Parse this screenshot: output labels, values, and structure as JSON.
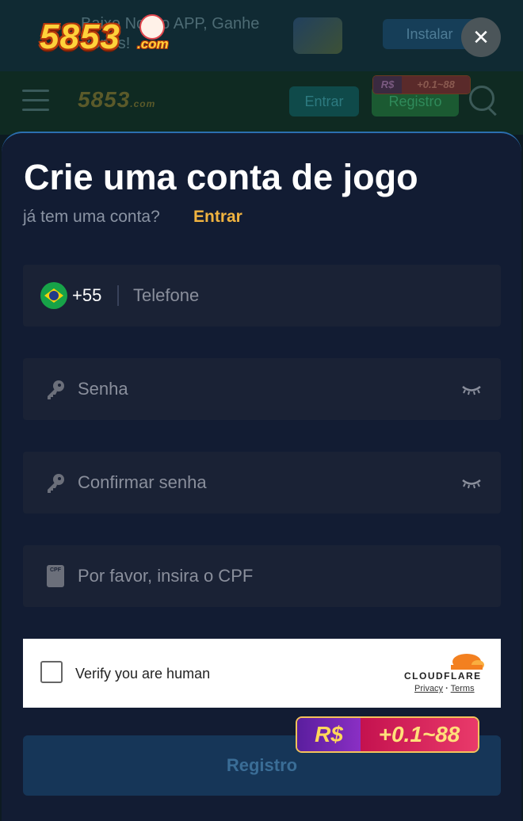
{
  "background": {
    "banner_text": "Baixe Nosso APP, Ganhe Bônus!",
    "install_label": "Instalar",
    "logo_number": "5853",
    "logo_domain": ".com",
    "topbar_login": "Entrar",
    "topbar_register": "Registro",
    "badge_currency": "R$",
    "badge_range": "+0.1~88"
  },
  "app_logo": {
    "number": "5853",
    "domain": ".com"
  },
  "close_icon": "close-icon",
  "modal": {
    "title": "Crie uma conta de jogo",
    "subtitle": "já tem uma conta?",
    "login_link": "Entrar"
  },
  "form": {
    "phone": {
      "country_code": "+55",
      "placeholder": "Telefone",
      "flag": "brazil-flag-icon"
    },
    "password": {
      "placeholder": "Senha"
    },
    "confirm_password": {
      "placeholder": "Confirmar senha"
    },
    "cpf": {
      "placeholder": "Por favor, insira o CPF",
      "icon_text": "CPF"
    },
    "submit_label": "Registro"
  },
  "captcha": {
    "label": "Verify you are human",
    "brand": "CLOUDFLARE",
    "privacy": "Privacy",
    "separator": "·",
    "terms": "Terms"
  },
  "promo": {
    "currency": "R$",
    "range": "+0.1~88"
  },
  "colors": {
    "modal_bg": "#121c33",
    "field_bg": "#1a2235",
    "accent_link": "#f0b340",
    "submit_bg": "#163658",
    "cloudflare_orange": "#f38020"
  }
}
